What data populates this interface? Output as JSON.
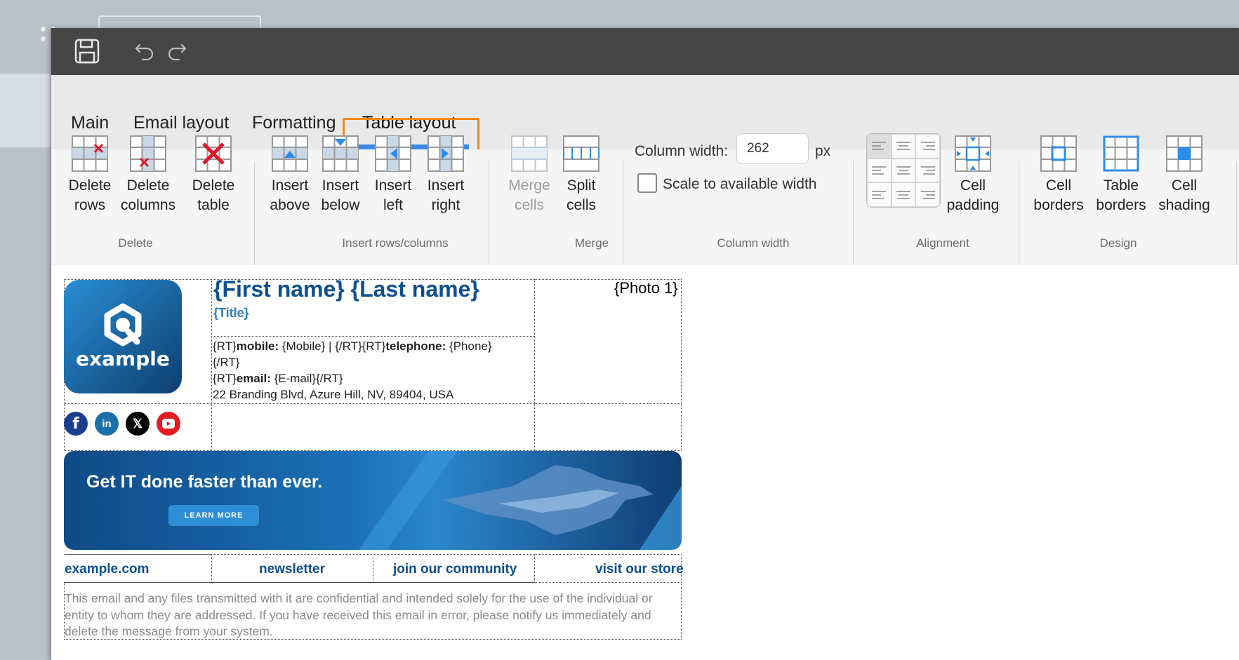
{
  "titlebar": {
    "save_icon": "save-icon",
    "undo_icon": "undo-icon",
    "redo_icon": "redo-icon"
  },
  "tabs": [
    {
      "label": "Main"
    },
    {
      "label": "Email layout"
    },
    {
      "label": "Formatting"
    },
    {
      "label": "Table layout",
      "active": true
    }
  ],
  "ribbon": {
    "delete": {
      "group_label": "Delete",
      "rows": [
        "Delete",
        "rows"
      ],
      "columns": [
        "Delete",
        "columns"
      ],
      "table": [
        "Delete",
        "table"
      ]
    },
    "insert": {
      "group_label": "Insert rows/columns",
      "above": [
        "Insert",
        "above"
      ],
      "below": [
        "Insert",
        "below"
      ],
      "left": [
        "Insert",
        "left"
      ],
      "right": [
        "Insert",
        "right"
      ]
    },
    "merge": {
      "group_label": "Merge",
      "merge": [
        "Merge",
        "cells"
      ],
      "split": [
        "Split",
        "cells"
      ]
    },
    "column_width": {
      "group_label": "Column width",
      "label": "Column width:",
      "value": "262",
      "unit": "px",
      "scale_label": "Scale to available width",
      "scale_checked": false
    },
    "alignment": {
      "group_label": "Alignment",
      "padding": [
        "Cell",
        "padding"
      ]
    },
    "design": {
      "group_label": "Design",
      "cell_borders": [
        "Cell",
        "borders"
      ],
      "table_borders": [
        "Table",
        "borders"
      ],
      "cell_shading": [
        "Cell",
        "shading"
      ]
    }
  },
  "signature": {
    "logo_text": "example",
    "name": "{First name} {Last name}",
    "title": "{Title}",
    "contact": {
      "rt1": "{RT}",
      "mobile_label": "mobile:",
      "mobile_value": " {Mobile}  |  {/RT}{RT}",
      "telephone_label": "telephone:",
      "telephone_value": " {Phone}",
      "rt_end": "{/RT}",
      "rt2": "{RT}",
      "email_label": "email:",
      "email_value": " {E-mail}{/RT}",
      "address": "22 Branding Blvd, Azure Hill, NV, 89404, USA"
    },
    "photo": "{Photo 1}",
    "social": [
      "facebook-icon",
      "linkedin-icon",
      "x-icon",
      "youtube-icon"
    ],
    "banner": {
      "headline_pre": "Get ",
      "headline_bold": "IT",
      "headline_post": " done faster than ever.",
      "button": "LEARN MORE"
    },
    "links": [
      "example.com",
      "newsletter",
      "join our community",
      "visit our store"
    ],
    "disclaimer": "This email and any files transmitted with it are confidential and intended solely for the use of the individual or entity to whom they are addressed. If you have received this email in error, please notify us immediately and delete the message from your system."
  },
  "colors": {
    "accent": "#3c8ae8",
    "highlight": "#f08a1c",
    "link": "#0e4f8e",
    "titlebar": "#464646"
  }
}
